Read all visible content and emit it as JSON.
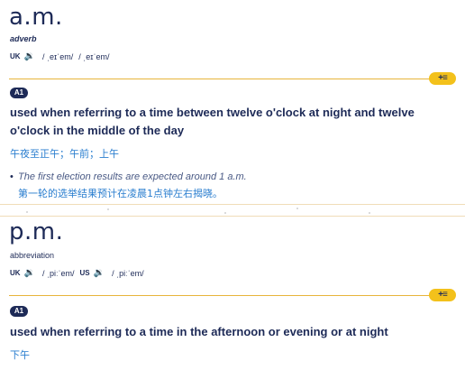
{
  "entries": [
    {
      "headword": "a.m.",
      "part_of_speech": "adverb",
      "pronunciations": [
        {
          "region": "UK",
          "icon": "speaker-icon",
          "ipa": [
            "/ ˌeɪˈem/",
            "/ ˌeɪˈem/"
          ]
        }
      ],
      "add_button_icon": "plus-list-icon",
      "level": "A1",
      "definition": "used when referring to a time between twelve o'clock at night and twelve o'clock in the middle of the day",
      "translation": "午夜至正午；午前；上午",
      "example": {
        "text": "The first election results are expected around 1 a.m.",
        "translation": "第一轮的选举结果预计在凌晨1点钟左右揭晓。"
      }
    },
    {
      "headword": "p.m.",
      "part_of_speech": "abbreviation",
      "pronunciations": [
        {
          "region": "UK",
          "icon": "speaker-icon",
          "ipa": "/ ˌpiːˈem/"
        },
        {
          "region": "US",
          "icon": "speaker-icon",
          "ipa": "/ ˌpiːˈem/"
        }
      ],
      "add_button_icon": "plus-list-icon",
      "level": "A1",
      "definition": "used when referring to a time in the afternoon or evening or at night",
      "translation": "下午"
    }
  ],
  "colors": {
    "navy": "#1d2a57",
    "accent_yellow": "#f3c11b",
    "rule": "#e8b53c",
    "translation_blue": "#2a7ecf"
  }
}
